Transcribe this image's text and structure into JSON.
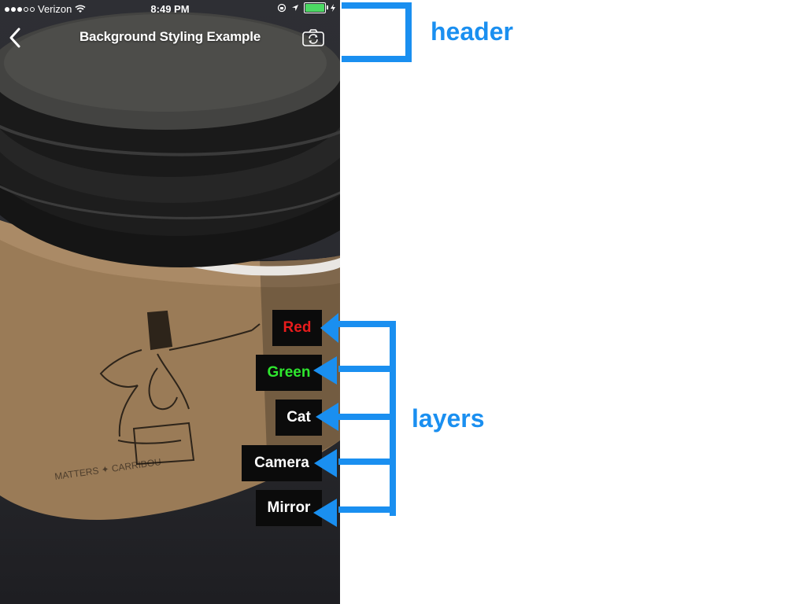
{
  "status_bar": {
    "carrier": "Verizon",
    "signal_dots": 3,
    "signal_dots_total": 5,
    "time": "8:49 PM",
    "battery_level": 1.0,
    "battery_color": "#4cd964"
  },
  "nav": {
    "title": "Background Styling Example",
    "back_icon": "chevron-left-icon",
    "camera_icon": "camera-flip-icon"
  },
  "layers": [
    {
      "key": "red",
      "label": "Red",
      "color": "#e81c1c"
    },
    {
      "key": "green",
      "label": "Green",
      "color": "#2ee62e"
    },
    {
      "key": "cat",
      "label": "Cat",
      "color": "#ffffff"
    },
    {
      "key": "camera",
      "label": "Camera",
      "color": "#ffffff"
    },
    {
      "key": "mirror",
      "label": "Mirror",
      "color": "#ffffff"
    }
  ],
  "annotations": {
    "header_label": "header",
    "layers_label": "layers",
    "accent_color": "#1a8ff0"
  }
}
